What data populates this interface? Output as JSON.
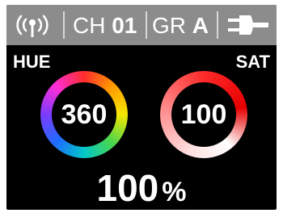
{
  "status_bar": {
    "wireless_icon": "wireless-signal-icon",
    "channel_prefix": "CH",
    "channel_value": "01",
    "group_prefix": "GR",
    "group_value": "A",
    "power_icon": "power-plug-icon"
  },
  "hue": {
    "label": "HUE",
    "value": "360"
  },
  "saturation": {
    "label": "SAT",
    "value": "100"
  },
  "intensity": {
    "value": "100",
    "unit": "%"
  },
  "colors": {
    "status_bar": "#8c8c8c",
    "screen": "#000000",
    "text": "#ffffff",
    "saturation_accent": "#e60000"
  }
}
